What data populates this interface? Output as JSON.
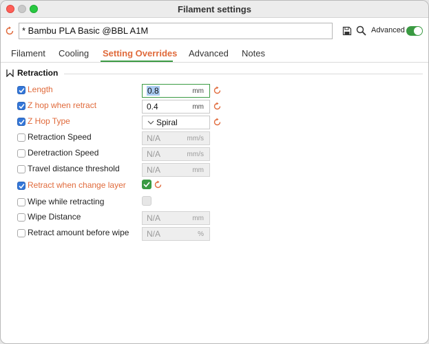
{
  "window": {
    "title": "Filament settings"
  },
  "toolbar": {
    "preset_name": "* Bambu PLA Basic @BBL A1M",
    "advanced_label": "Advanced",
    "advanced_on": true
  },
  "tabs": [
    {
      "label": "Filament",
      "active": false
    },
    {
      "label": "Cooling",
      "active": false
    },
    {
      "label": "Setting Overrides",
      "active": true
    },
    {
      "label": "Advanced",
      "active": false
    },
    {
      "label": "Notes",
      "active": false
    }
  ],
  "section": {
    "title": "Retraction"
  },
  "settings": [
    {
      "label": "Length",
      "checked": true,
      "modified": true,
      "value": "0.8",
      "unit": "mm"
    },
    {
      "label": "Z hop when retract",
      "checked": true,
      "modified": true,
      "value": "0.4",
      "unit": "mm"
    },
    {
      "label": "Z Hop Type",
      "checked": true,
      "modified": true,
      "value": "Spiral"
    },
    {
      "label": "Retraction Speed",
      "checked": false,
      "modified": false,
      "value": "N/A",
      "unit": "mm/s"
    },
    {
      "label": "Deretraction Speed",
      "checked": false,
      "modified": false,
      "value": "N/A",
      "unit": "mm/s"
    },
    {
      "label": "Travel distance threshold",
      "checked": false,
      "modified": false,
      "value": "N/A",
      "unit": "mm"
    },
    {
      "label": "Retract when change layer",
      "checked": true,
      "modified": true,
      "value_checked": true
    },
    {
      "label": "Wipe while retracting",
      "checked": false,
      "modified": false,
      "value_checked": false
    },
    {
      "label": "Wipe Distance",
      "checked": false,
      "modified": false,
      "value": "N/A",
      "unit": "mm"
    },
    {
      "label": "Retract amount before wipe",
      "checked": false,
      "modified": false,
      "value": "N/A",
      "unit": "%"
    }
  ],
  "colors": {
    "accent_orange": "#e06a3b",
    "accent_green": "#3a9a42",
    "checkbox_blue": "#3477d9"
  }
}
